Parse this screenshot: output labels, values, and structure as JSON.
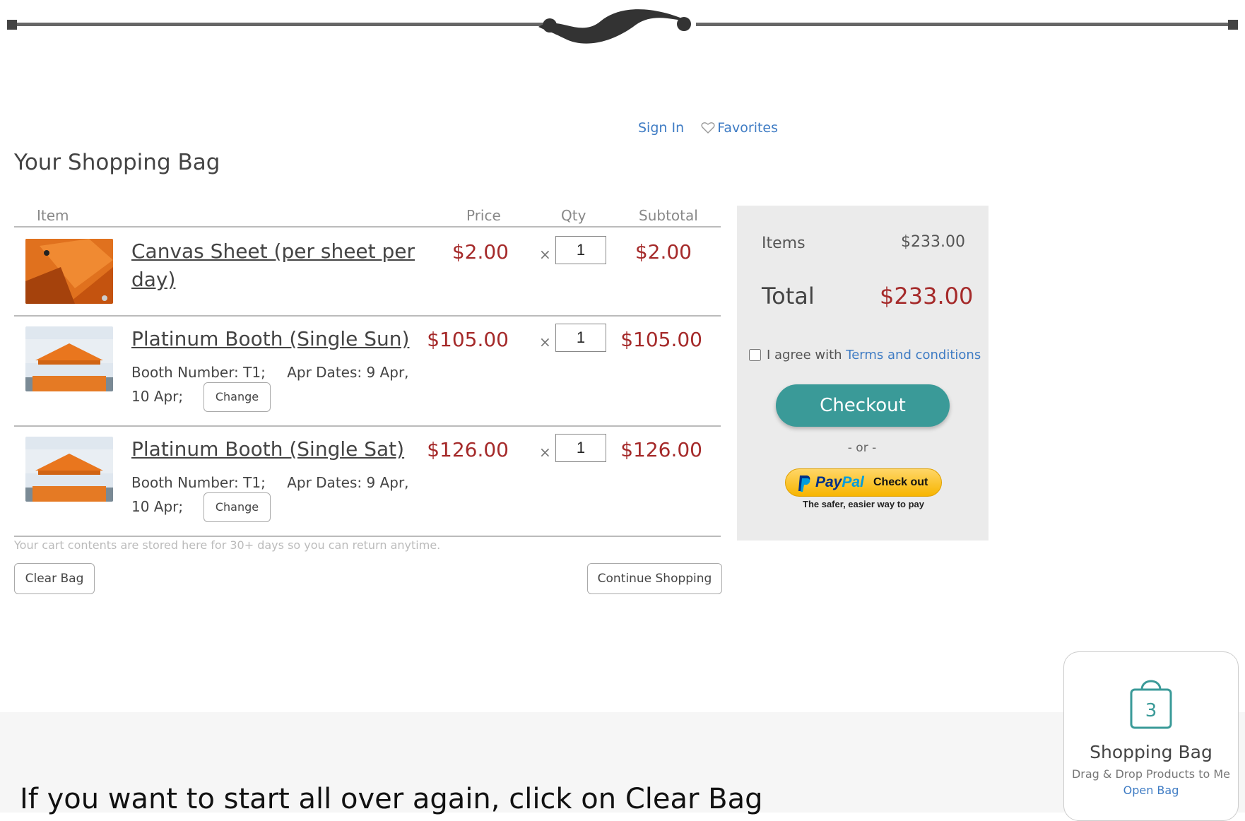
{
  "header": {
    "sign_in": "Sign In",
    "favorites": "Favorites"
  },
  "page_title": "Your Shopping Bag",
  "table": {
    "headers": {
      "item": "Item",
      "price": "Price",
      "qty": "Qty",
      "subtotal": "Subtotal"
    },
    "times_symbol": "×",
    "rows": [
      {
        "name_line1": "Canvas Sheet (per sheet per",
        "name_line2": "day)",
        "price": "$2.00",
        "qty": "1",
        "subtotal": "$2.00"
      },
      {
        "name": "Platinum Booth (Single Sun)",
        "booth": "Booth Number: T1;",
        "dates": "Apr Dates: 9 Apr,",
        "dates_2": "10 Apr;",
        "change": "Change",
        "price": "$105.00",
        "qty": "1",
        "subtotal": "$105.00"
      },
      {
        "name": "Platinum Booth (Single Sat)",
        "booth": "Booth Number: T1;",
        "dates": "Apr Dates: 9 Apr,",
        "dates_2": "10 Apr;",
        "change": "Change",
        "price": "$126.00",
        "qty": "1",
        "subtotal": "$126.00"
      }
    ]
  },
  "note": "Your cart contents are stored here for 30+ days so you can return anytime.",
  "buttons": {
    "clear_bag": "Clear Bag",
    "continue_shopping": "Continue Shopping"
  },
  "summary": {
    "items_label": "Items",
    "items_value": "$233.00",
    "total_label": "Total",
    "total_value": "$233.00",
    "agree_text": "I agree with",
    "terms_link": "Terms and conditions",
    "checkout": "Checkout",
    "or": "- or -",
    "paypal_pay": "Pay",
    "paypal_pal": "Pal",
    "paypal_check": "Check out",
    "paypal_sub": "The safer, easier way to pay"
  },
  "footer_text": "If you want to start all over again, click on Clear Bag",
  "bag_widget": {
    "count": "3",
    "title": "Shopping Bag",
    "subtitle": "Drag & Drop Products to Me",
    "open": "Open Bag"
  },
  "colors": {
    "accent": "#3a9a98",
    "price": "#a52a2a",
    "link": "#3f7cc4"
  }
}
